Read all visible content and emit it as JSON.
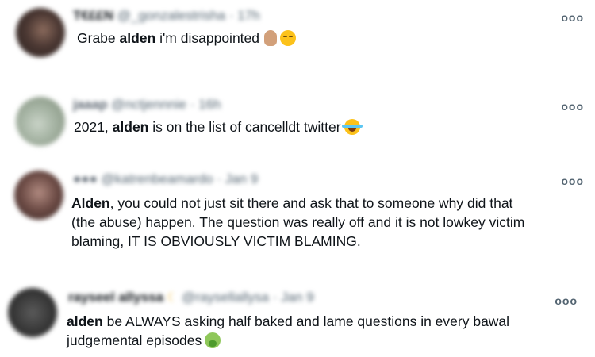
{
  "tweets": [
    {
      "display_name": "T€££N",
      "meta": "@_gonzalestrisha · 17h",
      "more_label": "ooo",
      "text_pre": "Grabe ",
      "text_bold": "alden",
      "text_post": " i'm disappointed",
      "emojis": [
        "raised-hand-icon",
        "pensive-face-icon"
      ]
    },
    {
      "display_name": "jaaap",
      "meta": "@nctjennnie · 16h",
      "more_label": "ooo",
      "text_pre": "2021, ",
      "text_bold": "alden",
      "text_post": " is on the list of cancelldt twitter",
      "emojis": [
        "tears-of-joy-icon"
      ]
    },
    {
      "display_name": "●●●",
      "meta": "@katrenbeamardo · Jan 9",
      "more_label": "ooo",
      "text_pre": "",
      "text_bold": "Alden",
      "text_post": ", you could not just sit there and ask that to someone why did that\n(the abuse) happen. The question was really off and it is not lowkey victim\nblaming, IT IS OBVIOUSLY VICTIM BLAMING.",
      "emojis": []
    },
    {
      "display_name": "rayseel allyssa",
      "meta": "@raysellallysa · Jan 9",
      "more_label": "ooo",
      "text_pre": "",
      "text_bold": "alden",
      "text_post": " be ALWAYS asking half baked and lame questions in every bawal\njudgemental episodes",
      "emojis": [
        "nauseated-face-icon"
      ]
    }
  ],
  "colors": {
    "text": "#0f1419",
    "secondary": "#536471",
    "background": "#ffffff"
  }
}
